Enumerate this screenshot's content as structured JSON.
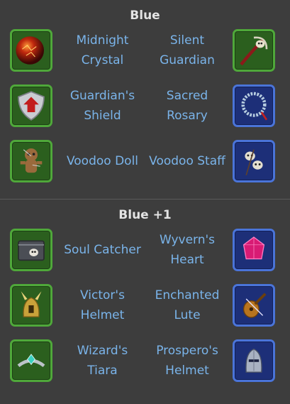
{
  "sections": [
    {
      "title": "Blue",
      "rows": [
        {
          "left_label": "Midnight\nCrystal",
          "left_icon": "red-orb-icon",
          "right_label": "Silent\nGuardian",
          "right_icon": "skull-staff-icon"
        },
        {
          "left_label": "Guardian's\nShield",
          "left_icon": "shield-icon",
          "right_label": "Sacred\nRosary",
          "right_icon": "rosary-icon"
        },
        {
          "left_label": "Voodoo Doll",
          "left_icon": "voodoo-doll-icon",
          "right_label": "Voodoo Staff",
          "right_icon": "skulls-staff-icon"
        }
      ]
    },
    {
      "title": "Blue +1",
      "rows": [
        {
          "left_label": "Soul Catcher",
          "left_icon": "skull-box-icon",
          "right_label": "Wyvern's\nHeart",
          "right_icon": "pink-gem-icon"
        },
        {
          "left_label": "Victor's\nHelmet",
          "left_icon": "winged-helmet-icon",
          "right_label": "Enchanted\nLute",
          "right_icon": "lute-icon"
        },
        {
          "left_label": "Wizard's\nTiara",
          "left_icon": "tiara-icon",
          "right_label": "Prospero's\nHelmet",
          "right_icon": "knight-helmet-icon"
        }
      ]
    }
  ],
  "colors": {
    "background": "#3d3d3d",
    "label": "#7ab4ea",
    "title": "#e4e4e4",
    "green_frame": "#4fa83a",
    "blue_frame": "#4a74d9"
  }
}
